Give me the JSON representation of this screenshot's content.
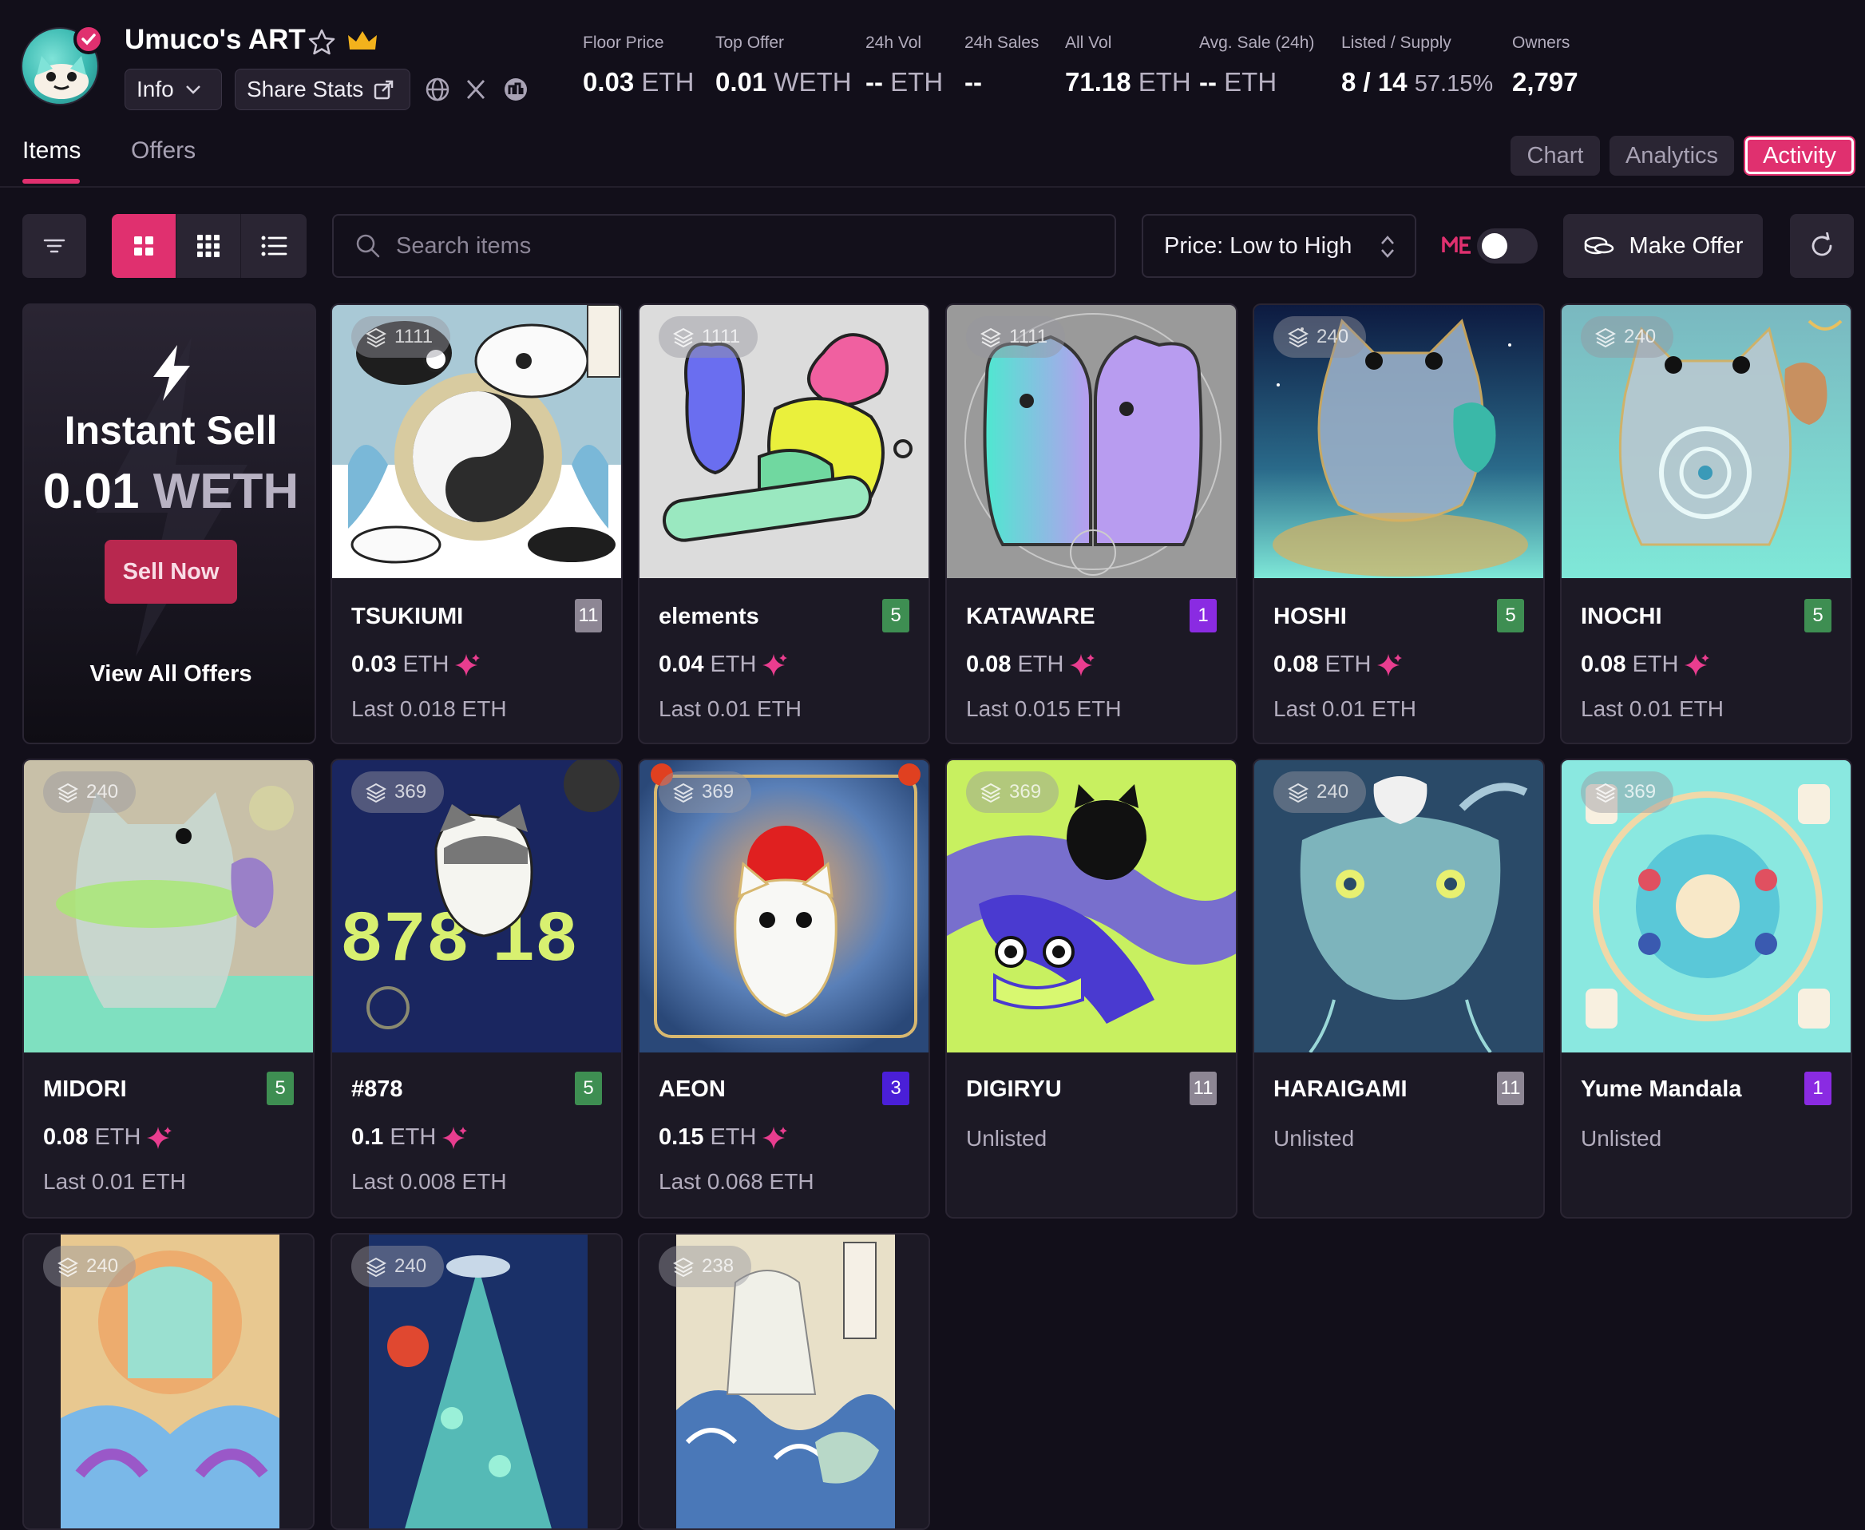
{
  "collection": {
    "title": "Umuco's ART",
    "info_label": "Info",
    "share_label": "Share Stats"
  },
  "stats": [
    {
      "label": "Floor Price",
      "value": "0.03",
      "unit": "ETH"
    },
    {
      "label": "Top Offer",
      "value": "0.01",
      "unit": "WETH"
    },
    {
      "label": "24h Vol",
      "value": "--",
      "unit": "ETH"
    },
    {
      "label": "24h Sales",
      "value": "--",
      "unit": ""
    },
    {
      "label": "All Vol",
      "value": "71.18",
      "unit": "ETH"
    },
    {
      "label": "Avg. Sale (24h)",
      "value": "--",
      "unit": "ETH"
    },
    {
      "label": "Listed / Supply",
      "value": "8 / 14",
      "unit": "57.15%"
    },
    {
      "label": "Owners",
      "value": "2,797",
      "unit": ""
    }
  ],
  "tabs": {
    "items": "Items",
    "offers": "Offers"
  },
  "views": {
    "chart": "Chart",
    "analytics": "Analytics",
    "activity": "Activity"
  },
  "toolbar": {
    "search_placeholder": "Search items",
    "sort_label": "Price: Low to High",
    "make_offer": "Make Offer"
  },
  "instant_sell": {
    "title": "Instant Sell",
    "price": "0.01",
    "unit": "WETH",
    "sell_button": "Sell Now",
    "view_offers": "View All Offers"
  },
  "items": [
    {
      "name": "TSUKIUMI",
      "copies": "1111",
      "qty": "11",
      "qty_color": "#8d8694",
      "price": "0.03",
      "unit": "ETH",
      "last": "Last 0.018 ETH",
      "listed": true
    },
    {
      "name": "elements",
      "copies": "1111",
      "qty": "5",
      "qty_color": "#3e8e52",
      "price": "0.04",
      "unit": "ETH",
      "last": "Last 0.01 ETH",
      "listed": true
    },
    {
      "name": "KATAWARE",
      "copies": "1111",
      "qty": "1",
      "qty_color": "#8a2be2",
      "price": "0.08",
      "unit": "ETH",
      "last": "Last 0.015 ETH",
      "listed": true
    },
    {
      "name": "HOSHI",
      "copies": "240",
      "qty": "5",
      "qty_color": "#3e8e52",
      "price": "0.08",
      "unit": "ETH",
      "last": "Last 0.01 ETH",
      "listed": true
    },
    {
      "name": "INOCHI",
      "copies": "240",
      "qty": "5",
      "qty_color": "#3e8e52",
      "price": "0.08",
      "unit": "ETH",
      "last": "Last 0.01 ETH",
      "listed": true
    },
    {
      "name": "MIDORI",
      "copies": "240",
      "qty": "5",
      "qty_color": "#3e8e52",
      "price": "0.08",
      "unit": "ETH",
      "last": "Last 0.01 ETH",
      "listed": true
    },
    {
      "name": "#878",
      "copies": "369",
      "qty": "5",
      "qty_color": "#3e8e52",
      "price": "0.1",
      "unit": "ETH",
      "last": "Last 0.008 ETH",
      "listed": true
    },
    {
      "name": "AEON",
      "copies": "369",
      "qty": "3",
      "qty_color": "#4a1fd8",
      "price": "0.15",
      "unit": "ETH",
      "last": "Last 0.068 ETH",
      "listed": true
    },
    {
      "name": "DIGIRYU",
      "copies": "369",
      "qty": "11",
      "qty_color": "#8d8694",
      "unlisted": "Unlisted",
      "listed": false
    },
    {
      "name": "HARAIGAMI",
      "copies": "240",
      "qty": "11",
      "qty_color": "#8d8694",
      "unlisted": "Unlisted",
      "listed": false
    },
    {
      "name": "Yume Mandala",
      "copies": "369",
      "qty": "1",
      "qty_color": "#8a2be2",
      "unlisted": "Unlisted",
      "listed": false
    },
    {
      "name": "",
      "copies": "240",
      "partial": true
    },
    {
      "name": "",
      "copies": "240",
      "partial": true
    },
    {
      "name": "",
      "copies": "238",
      "partial": true
    }
  ],
  "colors": {
    "accent": "#e0306f",
    "background": "#120f1a",
    "card": "#1c1925"
  }
}
